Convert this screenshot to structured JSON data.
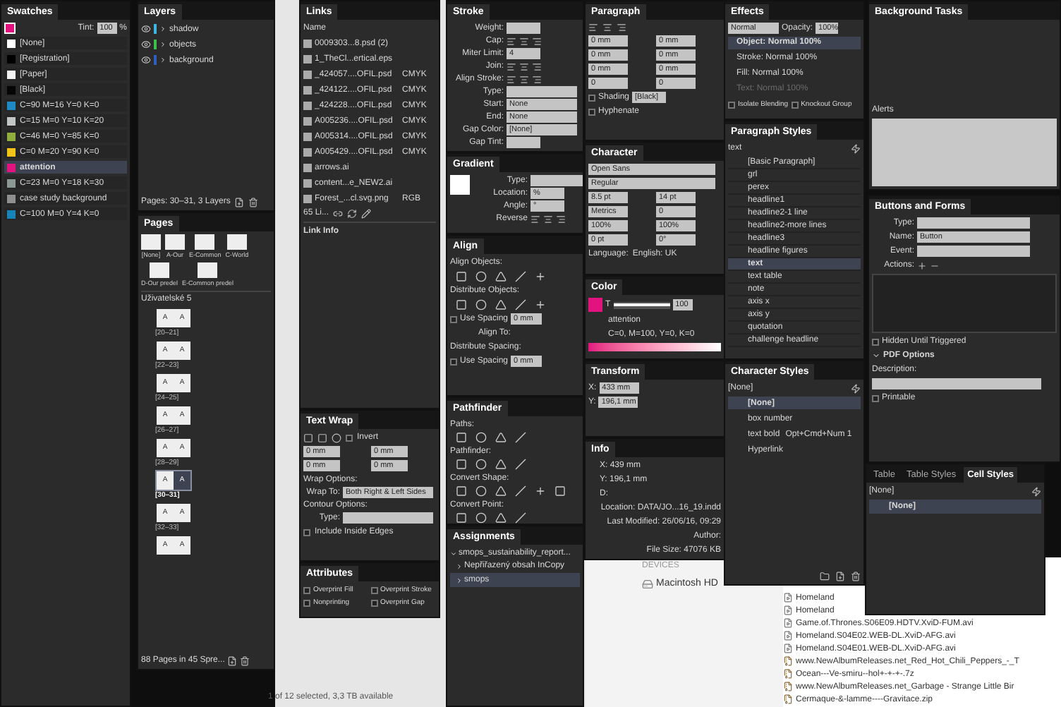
{
  "swatches": {
    "title": "Swatches",
    "tint_label": "Tint:",
    "tint": "100",
    "tint_unit": "%",
    "items": [
      {
        "name": "[None]",
        "color": "#ffffff",
        "selected": false
      },
      {
        "name": "[Registration]",
        "color": "#000000",
        "selected": false
      },
      {
        "name": "[Paper]",
        "color": "#f2f2f2",
        "selected": false
      },
      {
        "name": "[Black]",
        "color": "#050505",
        "selected": false
      },
      {
        "name": "C=90 M=16 Y=0 K=0",
        "color": "#1e8ac4",
        "selected": false
      },
      {
        "name": "C=15 M=0 Y=10 K=20",
        "color": "#c2c7c4",
        "selected": false
      },
      {
        "name": "C=46 M=0 Y=85 K=0",
        "color": "#8fae3e",
        "selected": false
      },
      {
        "name": "C=0 M=20 Y=90 K=0",
        "color": "#f2c417",
        "selected": false
      },
      {
        "name": "attention",
        "color": "#e2137f",
        "selected": true
      },
      {
        "name": "C=23 M=0 Y=18 K=30",
        "color": "#8a9a92",
        "selected": false
      },
      {
        "name": "case study background",
        "color": "#8f8f8f",
        "selected": false
      },
      {
        "name": "C=100 M=0 Y=4 K=0",
        "color": "#1784b8",
        "selected": false
      }
    ]
  },
  "layers": {
    "title": "Layers",
    "items": [
      {
        "name": "shadow",
        "color": "#3fb6e0"
      },
      {
        "name": "objects",
        "color": "#3ec04a"
      },
      {
        "name": "background",
        "color": "#2f5fbf"
      }
    ],
    "footer": "Pages: 30–31, 3 Layers"
  },
  "pages": {
    "title": "Pages",
    "masters": [
      {
        "label": "[None]"
      },
      {
        "label": "A-Our"
      },
      {
        "label": "E-Common"
      },
      {
        "label": "C-World"
      },
      {
        "label": "D-Our predel"
      },
      {
        "label": "E-Common predel"
      }
    ],
    "section": "Uživatelské 5",
    "spreads": [
      {
        "label": "[20–21]",
        "pages": [
          "A",
          "A"
        ],
        "selected": false
      },
      {
        "label": "[22–23]",
        "pages": [
          "A",
          "A"
        ],
        "selected": false
      },
      {
        "label": "[24–25]",
        "pages": [
          "A",
          "A"
        ],
        "selected": false
      },
      {
        "label": "[26–27]",
        "pages": [
          "A",
          "A"
        ],
        "selected": false
      },
      {
        "label": "[28–29]",
        "pages": [
          "A",
          "A"
        ],
        "selected": false
      },
      {
        "label": "[30–31]",
        "pages": [
          "A",
          "A"
        ],
        "selected": true
      },
      {
        "label": "[32–33]",
        "pages": [
          "A",
          "A"
        ],
        "selected": false
      },
      {
        "pages": [
          "A",
          "A"
        ],
        "selected": false
      }
    ],
    "footer": "88 Pages in 45 Spre..."
  },
  "links": {
    "title": "Links",
    "header": "Name",
    "items": [
      {
        "name": "0009303...8.psd (2)"
      },
      {
        "name": "1_TheCl...ertical.eps"
      },
      {
        "name": "_424057....OFIL.psd",
        "space": "CMYK"
      },
      {
        "name": "_424122....OFIL.psd",
        "space": "CMYK"
      },
      {
        "name": "_424228....OFIL.psd",
        "space": "CMYK"
      },
      {
        "name": "A005236....OFIL.psd",
        "space": "CMYK"
      },
      {
        "name": "A005314....OFIL.psd",
        "space": "CMYK"
      },
      {
        "name": "A005429....OFIL.psd",
        "space": "CMYK"
      },
      {
        "name": "arrows.ai"
      },
      {
        "name": "content...e_NEW2.ai"
      },
      {
        "name": "Forest_...cl.svg.png",
        "space": "RGB"
      }
    ],
    "count": "65 Li...",
    "info": "Link Info"
  },
  "text_wrap": {
    "title": "Text Wrap",
    "invert": {
      "label": "Invert",
      "checked": false
    },
    "offsets": [
      "0 mm",
      "0 mm",
      "0 mm",
      "0 mm"
    ],
    "rows": [
      {
        "kind": "heading",
        "label": "Wrap Options:"
      },
      {
        "kind": "select",
        "label": "Wrap To:",
        "value": "Both Right & Left Sides"
      },
      {
        "kind": "heading",
        "label": "Contour Options:"
      },
      {
        "kind": "select",
        "label": "Type:"
      }
    ],
    "inside_edges": {
      "label": "Include Inside Edges",
      "checked": false
    }
  },
  "attributes": {
    "title": "Attributes",
    "options": [
      {
        "label": "Overprint Fill",
        "checked": false
      },
      {
        "label": "Overprint Stroke",
        "checked": false
      },
      {
        "label": "Nonprinting",
        "checked": false
      },
      {
        "label": "Overprint Gap",
        "checked": false
      }
    ]
  },
  "stroke": {
    "title": "Stroke",
    "rows": [
      {
        "kind": "field",
        "label": "Weight:"
      },
      {
        "kind": "icons",
        "label": "Cap:"
      },
      {
        "kind": "field",
        "label": "Miter Limit:",
        "value": "4"
      },
      {
        "kind": "icons",
        "label": "Join:"
      },
      {
        "kind": "icons",
        "label": "Align Stroke:"
      },
      {
        "kind": "select",
        "label": "Type:"
      },
      {
        "kind": "select",
        "label": "Start:",
        "value": "None"
      },
      {
        "kind": "select",
        "label": "End:",
        "value": "None"
      },
      {
        "kind": "select",
        "label": "Gap Color:",
        "value": "[None]"
      },
      {
        "kind": "field",
        "label": "Gap Tint:"
      }
    ]
  },
  "gradient": {
    "title": "Gradient",
    "rows": [
      {
        "kind": "select",
        "label": "Type:"
      },
      {
        "kind": "field",
        "label": "Location:",
        "value": "%"
      },
      {
        "kind": "field",
        "label": "Angle:",
        "value": "°"
      },
      {
        "kind": "icons",
        "label": "Reverse"
      }
    ]
  },
  "align": {
    "title": "Align",
    "sections": [
      {
        "label": "Align Objects:"
      },
      {
        "label": "Distribute Objects:"
      }
    ],
    "use_spacing": {
      "label": "Use Spacing",
      "value": "0 mm",
      "checked": false
    },
    "align_to": "Align To:",
    "distribute_spacing": "Distribute Spacing:",
    "use_spacing_2": {
      "label": "Use Spacing",
      "value": "0 mm",
      "checked": false
    }
  },
  "pathfinder": {
    "title": "Pathfinder",
    "sections": [
      {
        "label": "Paths:"
      },
      {
        "label": "Pathfinder:"
      },
      {
        "label": "Convert Shape:"
      },
      {
        "label": "Convert Point:"
      }
    ]
  },
  "assignments": {
    "title": "Assignments",
    "items": [
      {
        "name": "smops_sustainability_report...",
        "selected": false,
        "children": [
          {
            "name": "Nepřiřazený obsah InCopy",
            "selected": false
          },
          {
            "name": "smops",
            "selected": true
          }
        ]
      }
    ]
  },
  "paragraph": {
    "title": "Paragraph",
    "fields": [
      "0 mm",
      "0 mm",
      "0 mm",
      "0 mm",
      "0 mm",
      "0 mm",
      "0",
      "0"
    ],
    "shading": {
      "label": "Shading",
      "checked": false,
      "swatch": "[Black]"
    },
    "hyphenate": {
      "label": "Hyphenate",
      "checked": false
    }
  },
  "character": {
    "title": "Character",
    "font": "Open Sans",
    "style": "Regular",
    "fields": [
      "8.5 pt",
      "14 pt",
      "Metrics",
      "0",
      "100%",
      "100%",
      "0 pt",
      "0°"
    ],
    "language_label": "Language:",
    "language": "English: UK"
  },
  "color": {
    "title": "Color",
    "tint_label": "T",
    "level": 1,
    "value": "100",
    "name": "attention",
    "formula": "C=0, M=100, Y=0, K=0"
  },
  "transform": {
    "title": "Transform",
    "x_label": "X:",
    "x": "433 mm",
    "y_label": "Y:",
    "y": "196,1 mm"
  },
  "info": {
    "title": "Info",
    "lines": [
      "X: 439 mm",
      "Y: 196,1 mm",
      "D:"
    ],
    "details": [
      "Location: DATA/JO...16_19.indd",
      "Last Modified: 26/06/16, 09:29",
      "Author:",
      "File Size: 47076 KB"
    ]
  },
  "effects": {
    "title": "Effects",
    "blend": "Normal",
    "opacity_label": "Opacity:",
    "opacity": "100%",
    "items": [
      {
        "name": "Object: Normal 100%",
        "selected": true,
        "disabled": false
      },
      {
        "name": "Stroke: Normal 100%",
        "selected": false,
        "disabled": false
      },
      {
        "name": "Fill: Normal 100%",
        "selected": false,
        "disabled": false
      },
      {
        "name": "Text: Normal 100%",
        "selected": false,
        "disabled": true
      }
    ],
    "options": [
      {
        "label": "Isolate Blending",
        "checked": false
      },
      {
        "label": "Knockout Group",
        "checked": false
      }
    ]
  },
  "paragraph_styles": {
    "title": "Paragraph Styles",
    "current": "text",
    "items": [
      {
        "name": "[Basic Paragraph]",
        "selected": false
      },
      {
        "name": "grl",
        "selected": false
      },
      {
        "name": "perex",
        "selected": false
      },
      {
        "name": "headline1",
        "selected": false
      },
      {
        "name": "headline2-1 line",
        "selected": false
      },
      {
        "name": "headline2-more lines",
        "selected": false
      },
      {
        "name": "headline3",
        "selected": false
      },
      {
        "name": "headline figures",
        "selected": false
      },
      {
        "name": "text",
        "selected": true
      },
      {
        "name": "text table",
        "selected": false
      },
      {
        "name": "note",
        "selected": false
      },
      {
        "name": "axis x",
        "selected": false
      },
      {
        "name": "axis y",
        "selected": false
      },
      {
        "name": "quotation",
        "selected": false
      },
      {
        "name": "challenge headline",
        "selected": false
      }
    ]
  },
  "character_styles": {
    "title": "Character Styles",
    "current": "[None]",
    "items": [
      {
        "name": "[None]",
        "selected": true
      },
      {
        "name": "box number",
        "selected": false
      },
      {
        "name": "text bold",
        "shortcut": "Opt+Cmd+Num 1",
        "selected": false
      },
      {
        "name": "Hyperlink",
        "selected": false
      }
    ]
  },
  "background_tasks": {
    "title": "Background Tasks",
    "alerts": "Alerts"
  },
  "buttons_and_forms": {
    "title": "Buttons and Forms",
    "type_label": "Type:",
    "name_label": "Name:",
    "name": "Button",
    "event_label": "Event:",
    "actions_label": "Actions:",
    "hidden": {
      "label": "Hidden Until Triggered",
      "checked": false
    },
    "pdf_options": {
      "label": "PDF Options",
      "expanded": true
    },
    "description_label": "Description:",
    "printable": {
      "label": "Printable",
      "checked": false
    }
  },
  "cell_styles": {
    "tabs": [
      {
        "label": "Table",
        "selected": false
      },
      {
        "label": "Table Styles",
        "selected": false
      },
      {
        "label": "Cell Styles",
        "selected": true
      }
    ],
    "current": "[None]",
    "items": [
      {
        "name": "[None]",
        "selected": true
      }
    ]
  },
  "finder": {
    "sidebar_heading": "DEVICES",
    "device": "Macintosh HD",
    "files": [
      "Homeland",
      "Homeland",
      "Game.of.Thrones.S06E09.HDTV.XviD-FUM.avi",
      "Homeland.S04E02.WEB-DL.XviD-AFG.avi",
      "Homeland.S04E01.WEB-DL.XviD-AFG.avi",
      "www.NewAlbumReleases.net_Red_Hot_Chili_Peppers_-_T",
      "Ocean---Ve-smiru--hol+-+-+-.7z",
      "www.NewAlbumReleases.net_Garbage - Strange Little Bir",
      "Cermaque-&-lamme----Gravitace.zip"
    ],
    "status": "1 of 12 selected, 3,3 TB available"
  }
}
